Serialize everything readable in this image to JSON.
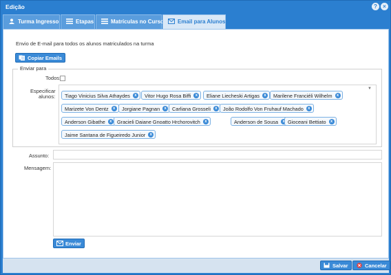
{
  "window": {
    "title": "Edição"
  },
  "tabs": [
    {
      "label": "Turma Ingresso"
    },
    {
      "label": "Etapas"
    },
    {
      "label": "Matrículas no Curso"
    },
    {
      "label": "Email para Alunos"
    }
  ],
  "email": {
    "description": "Envio de E-mail para todos os alunos matriculados na turma",
    "copy_button": "Copiar Emails",
    "fieldset_legend": "Enviar para",
    "all_label": "Todos:",
    "specify_label_line1": "Especificar",
    "specify_label_line2": "alunos:",
    "students": [
      "Tiago Vinicius Silva Athaydes",
      "Vitor Hugo Rosa Biffi",
      "Eliane Liecheski Artigas",
      "Marilene Franciéli Wilhelm",
      "Marizete Von Dentz",
      "Jorgiane Pagnan",
      "Carliana Grosseli",
      "João Rodolfo Von Fruhauf Machado",
      "Anderson Gibathe",
      "Gracieli Daiane Gnoatto Hrchorovitch",
      "Anderson de Sousa",
      "Gioceani Bettiato",
      "Jaime Santana de Figueiredo Junior"
    ],
    "subject_label": "Assunto:",
    "message_label": "Mensagem:",
    "send_button": "Enviar"
  },
  "footer": {
    "save_button": "Salvar",
    "cancel_button": "Cancelar"
  }
}
